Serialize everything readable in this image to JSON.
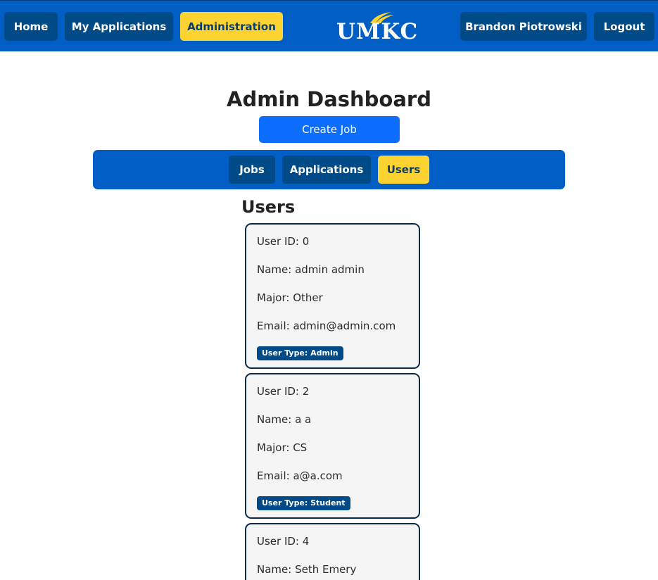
{
  "nav": {
    "home": "Home",
    "my_applications": "My Applications",
    "administration": "Administration",
    "user_name": "Brandon Piotrowski",
    "logout": "Logout",
    "logo_text": "UMKC"
  },
  "colors": {
    "primary": "#005ec4",
    "button_dark": "#004a87",
    "accent_gold": "#fdd331",
    "create_blue": "#0d6efd"
  },
  "page": {
    "title": "Admin Dashboard",
    "create_job": "Create Job"
  },
  "tabs": [
    {
      "label": "Jobs",
      "active": false
    },
    {
      "label": "Applications",
      "active": false
    },
    {
      "label": "Users",
      "active": true
    }
  ],
  "users_section": {
    "title": "Users"
  },
  "users": [
    {
      "id_line": "User ID: 0",
      "name_line": "Name: admin admin",
      "major_line": "Major: Other",
      "email_line": "Email: admin@admin.com",
      "type_badge": "User Type: Admin"
    },
    {
      "id_line": "User ID: 2",
      "name_line": "Name: a a",
      "major_line": "Major: CS",
      "email_line": "Email: a@a.com",
      "type_badge": "User Type: Student"
    },
    {
      "id_line": "User ID: 4",
      "name_line": "Name: Seth Emery"
    }
  ]
}
